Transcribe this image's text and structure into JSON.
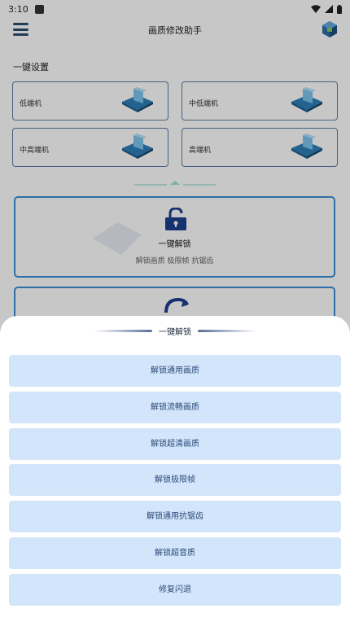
{
  "status_bar": {
    "time": "3:10"
  },
  "header": {
    "title": "画质修改助手"
  },
  "preset_section": {
    "title": "一键设置",
    "devices": [
      {
        "label": "低端机"
      },
      {
        "label": "中低端机"
      },
      {
        "label": "中高端机"
      },
      {
        "label": "高端机"
      }
    ]
  },
  "unlock_card": {
    "title": "一键解锁",
    "description": "解锁画质 极限帧 抗锯齿"
  },
  "sheet": {
    "title": "一键解锁",
    "options": [
      {
        "label": "解锁通用画质"
      },
      {
        "label": "解锁流畅画质"
      },
      {
        "label": "解锁超清画质"
      },
      {
        "label": "解锁极限帧"
      },
      {
        "label": "解锁通用抗锯齿"
      },
      {
        "label": "解锁超音质"
      },
      {
        "label": "修复闪退"
      }
    ]
  },
  "colors": {
    "accent": "#3a8fd8",
    "option_bg": "#d3e5fb",
    "option_text": "#2a4a78"
  }
}
